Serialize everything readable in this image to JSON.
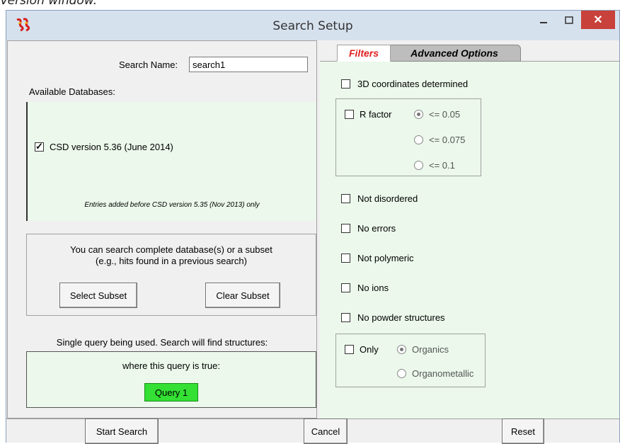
{
  "caption": "Version window.",
  "window": {
    "title": "Search Setup",
    "close_label": "✕"
  },
  "left": {
    "search_name_label": "Search Name:",
    "search_name_value": "search1",
    "available_label": "Available Databases:",
    "database": {
      "label": "CSD version 5.36 (June 2014)",
      "checked": true,
      "note": "Entries added before CSD version 5.35 (Nov 2013) only"
    },
    "subset": {
      "line1": "You can search complete database(s) or a subset",
      "line2": "(e.g., hits found in a previous search)",
      "select_label": "Select Subset",
      "clear_label": "Clear Subset"
    },
    "query": {
      "summary": "Single query being used. Search will find structures:",
      "condition": "where this query is true:",
      "button_label": "Query 1"
    }
  },
  "tabs": [
    {
      "label": "Filters",
      "active": true
    },
    {
      "label": "Advanced Options",
      "active": false
    }
  ],
  "filters": {
    "coords": "3D coordinates determined",
    "r_factor": {
      "label": "R factor",
      "options": [
        "<= 0.05",
        "<= 0.075",
        "<= 0.1"
      ],
      "selected": "<= 0.05"
    },
    "not_disordered": "Not disordered",
    "no_errors": "No errors",
    "not_polymeric": "Not polymeric",
    "no_ions": "No ions",
    "no_powder": "No powder structures",
    "only": {
      "label": "Only",
      "options": [
        "Organics",
        "Organometallic"
      ],
      "selected": "Organics"
    }
  },
  "footer": {
    "start_label": "Start Search",
    "cancel_label": "Cancel",
    "reset_label": "Reset"
  }
}
